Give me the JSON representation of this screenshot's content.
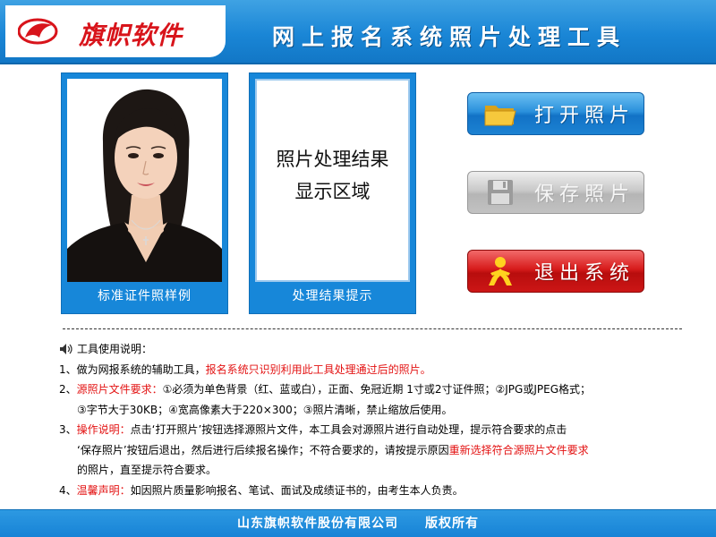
{
  "header": {
    "logo_text": "旗帜软件",
    "title": "网上报名系统照片处理工具"
  },
  "panels": {
    "sample_caption": "标准证件照样例",
    "result_caption": "处理结果提示",
    "result_hint_line1": "照片处理结果",
    "result_hint_line2": "显示区域"
  },
  "buttons": {
    "open_label": "打开照片",
    "save_label": "保存照片",
    "exit_label": "退出系统"
  },
  "instructions": {
    "title": "工具使用说明：",
    "item1_prefix": "1、做为网报系统的辅助工具，",
    "item1_red": "报名系统只识别利用此工具处理通过后的照片。",
    "item2_prefix": "2、",
    "item2_red": "源照片文件要求：",
    "item2_text": "①必须为单色背景（红、蓝或白），正面、免冠近期 1寸或2寸证件照；②JPG或JPEG格式；",
    "item2_line2": "③字节大于30KB；④宽高像素大于220×300；③照片清晰，禁止缩放后使用。",
    "item3_prefix": "3、",
    "item3_red": "操作说明：",
    "item3_text": "点击‘打开照片’按钮选择源照片文件，本工具会对源照片进行自动处理，提示符合要求的点击",
    "item3_line2_text": "‘保存照片’按钮后退出，然后进行后续报名操作；不符合要求的，请按提示原因",
    "item3_line2_red": "重新选择符合源照片文件要求",
    "item3_line3": "的照片，直至提示符合要求。",
    "item4_prefix": "4、",
    "item4_red": "温馨声明：",
    "item4_text": "如因照片质量影响报名、笔试、面试及成绩证书的，由考生本人负责。"
  },
  "footer": {
    "text": "山东旗帜软件股份有限公司　　版权所有"
  },
  "colors": {
    "brand_blue": "#1787d9",
    "brand_red": "#d8141b",
    "notice_red": "#e31212"
  },
  "icons": {
    "open": "folder-icon",
    "save": "floppy-disk-icon",
    "exit": "running-man-icon",
    "instructions": "speaker-icon",
    "logo": "flag-logo-icon"
  }
}
